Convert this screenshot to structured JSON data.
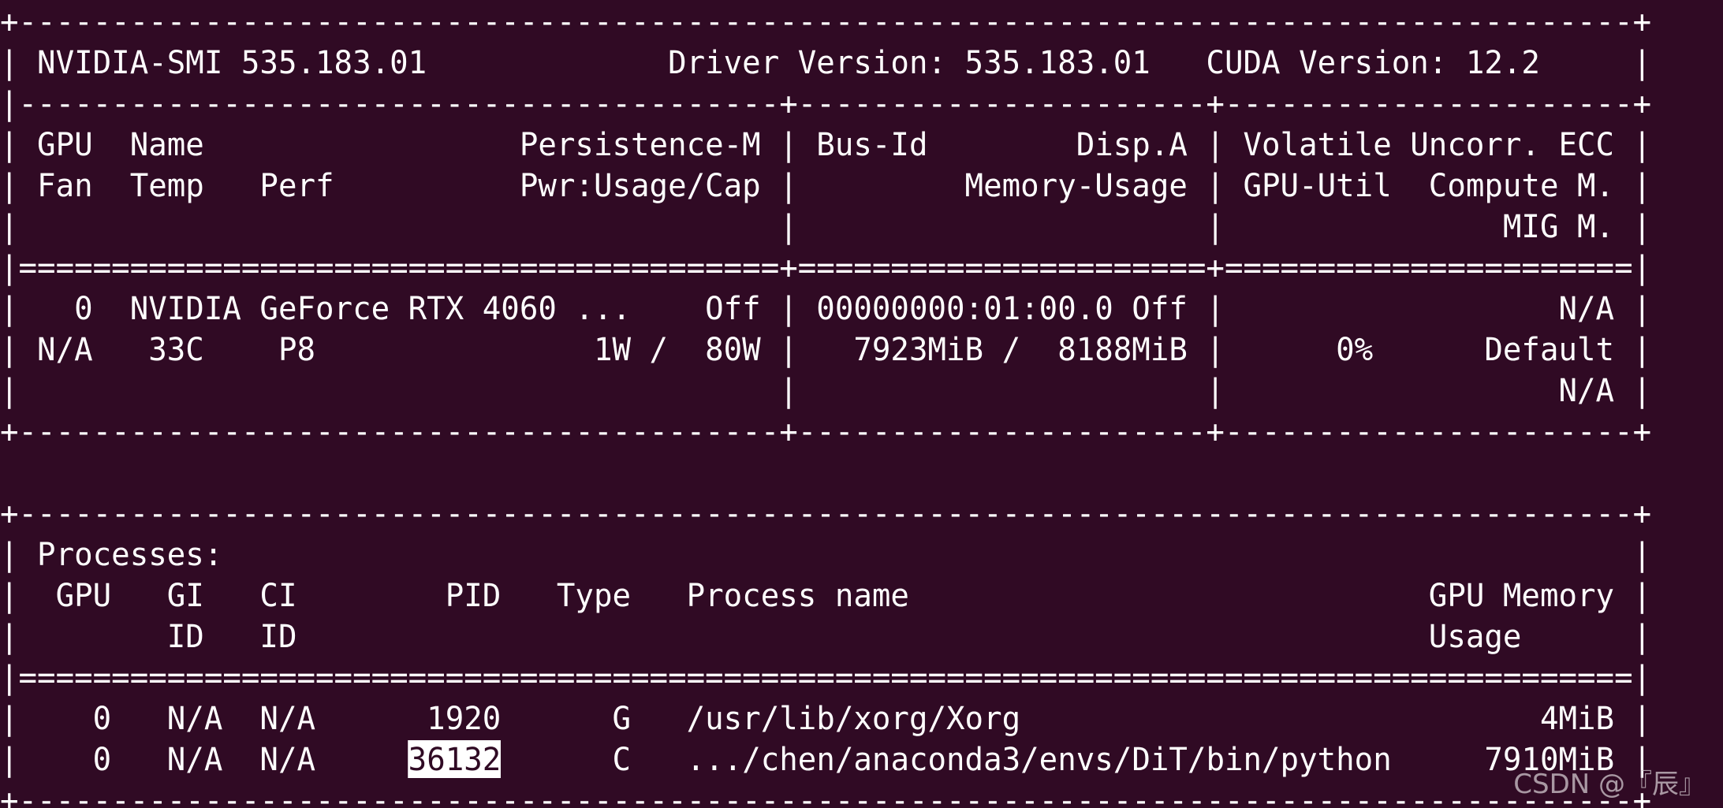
{
  "window": {
    "background_color": "#300a24",
    "text_color": "#ffffff"
  },
  "terminal_lines": [
    "+---------------------------------------------------------------------------------------+",
    "| NVIDIA-SMI 535.183.01             Driver Version: 535.183.01   CUDA Version: 12.2     |",
    "|-----------------------------------------+----------------------+----------------------+",
    "| GPU  Name                 Persistence-M | Bus-Id        Disp.A | Volatile Uncorr. ECC |",
    "| Fan  Temp   Perf          Pwr:Usage/Cap |         Memory-Usage | GPU-Util  Compute M. |",
    "|                                         |                      |               MIG M. |",
    "|=========================================+======================+======================|",
    "|   0  NVIDIA GeForce RTX 4060 ...    Off | 00000000:01:00.0 Off |                  N/A |",
    "| N/A   33C    P8               1W /  80W |   7923MiB /  8188MiB |      0%      Default |",
    "|                                         |                      |                  N/A |",
    "+-----------------------------------------+----------------------+----------------------+",
    "",
    "+---------------------------------------------------------------------------------------+",
    "| Processes:                                                                            |",
    "|  GPU   GI   CI        PID   Type   Process name                            GPU Memory |",
    "|        ID   ID                                                             Usage      |",
    "|=======================================================================================|",
    "|    0   N/A  N/A      1920      G   /usr/lib/xorg/Xorg                            4MiB |",
    "|    0   N/A  N/A     "
  ],
  "highlighted_pid": "36132",
  "last_line_rest": "      C   .../chen/anaconda3/envs/DiT/bin/python     7910MiB |",
  "bottom_border": "+---------------------------------------------------------------------------------------+",
  "watermark": "CSDN @『辰』"
}
